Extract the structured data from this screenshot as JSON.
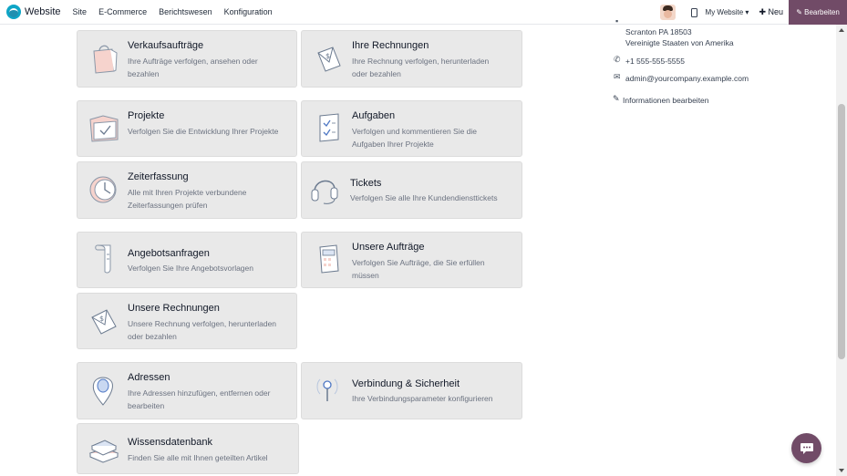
{
  "header": {
    "brand": "Website",
    "nav": [
      "Site",
      "E-Commerce",
      "Berichtswesen",
      "Konfiguration"
    ],
    "site_select": "My Website ▾",
    "new_label": "✚ Neu",
    "edit_label": "✎ Bearbeiten"
  },
  "cards": [
    {
      "title": "Verkaufsaufträge",
      "desc": "Ihre Aufträge verfolgen, ansehen oder bezahlen",
      "icon": "shopping-bag-icon"
    },
    {
      "title": "Ihre Rechnungen",
      "desc": "Ihre Rechnung verfolgen, herunterladen oder bezahlen",
      "icon": "invoice-icon"
    },
    {
      "title": "Projekte",
      "desc": "Verfolgen Sie die Entwicklung Ihrer Projekte",
      "icon": "folder-icon"
    },
    {
      "title": "Aufgaben",
      "desc": "Verfolgen und kommentieren Sie die Aufgaben Ihrer Projekte",
      "icon": "task-icon"
    },
    {
      "title": "Zeiterfassung",
      "desc": "Alle mit Ihren Projekte verbundene Zeiterfassungen prüfen",
      "icon": "clock-icon"
    },
    {
      "title": "Tickets",
      "desc": "Verfolgen Sie alle Ihre Kundendiensttickets",
      "icon": "headset-icon"
    },
    {
      "title": "Angebotsanfragen",
      "desc": "Verfolgen Sie Ihre Angebotsvorlagen",
      "icon": "scroll-icon"
    },
    {
      "title": "Unsere Aufträge",
      "desc": "Verfolgen Sie Aufträge, die Sie erfüllen müssen",
      "icon": "calculator-icon"
    },
    {
      "title": "Unsere Rechnungen",
      "desc": "Unsere Rechnung verfolgen, herunterladen oder bezahlen",
      "icon": "envelope-invoice-icon"
    },
    {
      "title": "Adressen",
      "desc": "Ihre Adressen hinzufügen, entfernen oder bearbeiten",
      "icon": "map-pin-icon"
    },
    {
      "title": "Verbindung & Sicherheit",
      "desc": "Ihre Verbindungsparameter konfigurieren",
      "icon": "key-icon"
    },
    {
      "title": "Wissensdatenbank",
      "desc": "Finden Sie alle mit Ihnen geteilten Artikel",
      "icon": "books-icon"
    }
  ],
  "sidebar": {
    "address_line1": "Scranton PA 18503",
    "address_line2": "Vereinigte Staaten von Amerika",
    "phone": "+1 555-555-5555",
    "email": "admin@yourcompany.example.com",
    "edit_info": "Informationen bearbeiten"
  },
  "colors": {
    "accent": "#714b67",
    "card_bg": "#e9e9e9"
  }
}
